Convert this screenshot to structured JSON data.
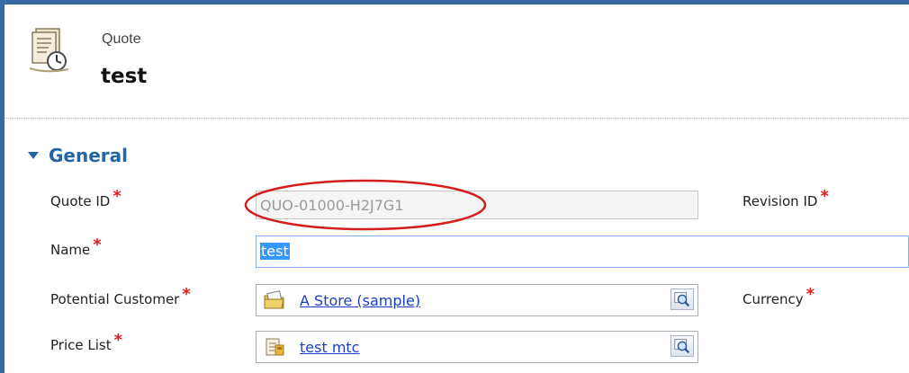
{
  "header": {
    "entity_type": "Quote",
    "record_name": "test"
  },
  "section": {
    "title": "General"
  },
  "fields": {
    "quote_id": {
      "label": "Quote ID",
      "value": "QUO-01000-H2J7G1"
    },
    "revision_id": {
      "label": "Revision ID"
    },
    "name": {
      "label": "Name",
      "value": "test"
    },
    "potential_customer": {
      "label": "Potential Customer",
      "value": "A Store (sample)"
    },
    "currency": {
      "label": "Currency"
    },
    "price_list": {
      "label": "Price List",
      "value": "test mtc"
    }
  },
  "colors": {
    "frame": "#3a6aa3",
    "section_title": "#2465a8",
    "required_marker": "#e01b1b",
    "link": "#1a3fc4",
    "highlight_ring": "#d31c1c",
    "selection": "#3399ff"
  },
  "icons": {
    "entity": "quote-document-icon",
    "section_toggle": "triangle-down-icon",
    "customer": "account-folder-icon",
    "price_list": "price-list-icon",
    "lookup": "lookup-magnifier-icon"
  }
}
